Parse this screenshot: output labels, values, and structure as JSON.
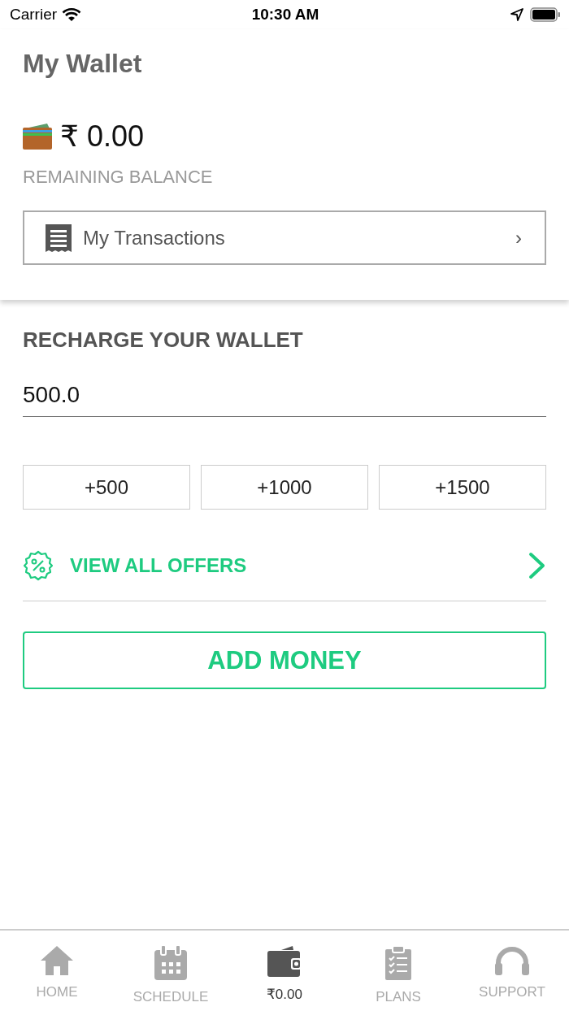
{
  "status_bar": {
    "carrier": "Carrier",
    "time": "10:30 AM"
  },
  "header": {
    "title": "My Wallet",
    "balance": "₹ 0.00",
    "balance_label": "REMAINING BALANCE",
    "transactions_link": "My Transactions",
    "chevron": "›"
  },
  "recharge": {
    "title": "RECHARGE YOUR WALLET",
    "amount": "500.0",
    "quick_amounts": [
      "+500",
      "+1000",
      "+1500"
    ],
    "offers_link": "VIEW ALL OFFERS",
    "add_button": "ADD MONEY"
  },
  "tab_bar": [
    {
      "kind": "home",
      "label": "HOME",
      "selected": false
    },
    {
      "kind": "schedule",
      "label": "SCHEDULE",
      "selected": false
    },
    {
      "kind": "wallet",
      "label": "₹0.00",
      "selected": true
    },
    {
      "kind": "plans",
      "label": "PLANS",
      "selected": false
    },
    {
      "kind": "support",
      "label": "SUPPORT",
      "selected": false
    }
  ]
}
